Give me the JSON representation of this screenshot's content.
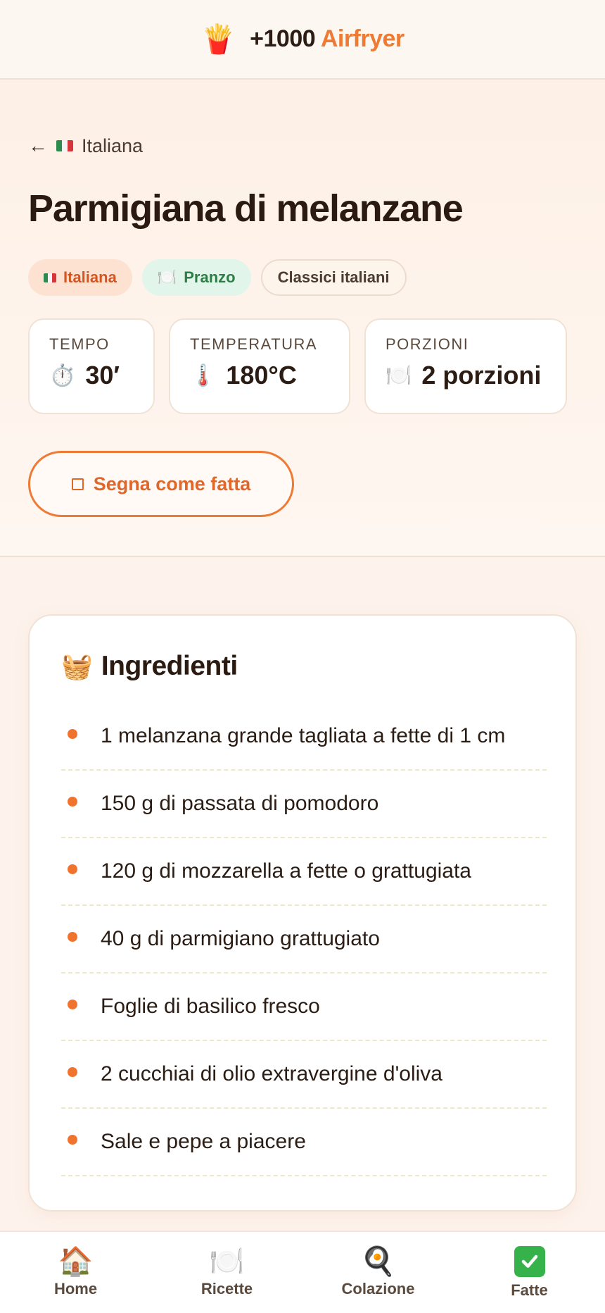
{
  "header": {
    "logo_icon": "🍟",
    "brand_number": "+1000",
    "brand_name": "Airfryer",
    "accent_color": "#ef7a33"
  },
  "breadcrumb": {
    "back_icon": "arrow-left-icon",
    "category": "Italiana"
  },
  "recipe": {
    "title": "Parmigiana di melanzane",
    "tags": [
      {
        "label": "Italiana",
        "icon": "italian-flag-icon"
      },
      {
        "label": "Pranzo",
        "icon": "plate-icon"
      },
      {
        "label": "Classici italiani"
      }
    ],
    "stats": [
      {
        "label": "TEMPO",
        "icon": "⏱️",
        "value": "30′"
      },
      {
        "label": "TEMPERATURA",
        "icon": "🌡️",
        "value": "180°C"
      },
      {
        "label": "PORZIONI",
        "icon": "🍽️",
        "value": "2 porzioni"
      }
    ],
    "mark_done_label": "Segna come fatta"
  },
  "ingredients": {
    "icon": "🧺",
    "title": "Ingredienti",
    "items": [
      "1 melanzana grande tagliata a fette di 1 cm",
      "150 g di passata di pomodoro",
      "120 g di mozzarella a fette o grattugiata",
      "40 g di parmigiano grattugiato",
      "Foglie di basilico fresco",
      "2 cucchiai di olio extravergine d'oliva",
      "Sale e pepe a piacere"
    ]
  },
  "nav": [
    {
      "label": "Home",
      "icon": "🏠"
    },
    {
      "label": "Ricette",
      "icon": "🍽️"
    },
    {
      "label": "Colazione",
      "icon": "🍳"
    },
    {
      "label": "Fatte",
      "icon": "✔"
    }
  ]
}
